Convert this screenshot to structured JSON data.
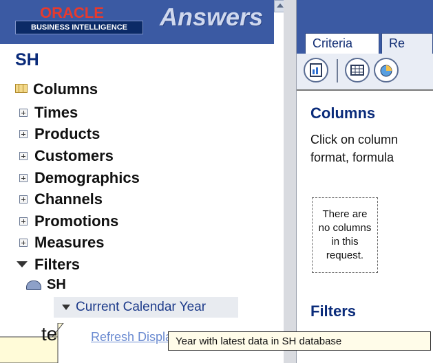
{
  "header": {
    "oracle_label": "ORACLE",
    "bi_label": "BUSINESS INTELLIGENCE",
    "app_title": "Answers"
  },
  "left": {
    "subject_area": "SH",
    "columns_label": "Columns",
    "tree": [
      "Times",
      "Products",
      "Customers",
      "Demographics",
      "Channels",
      "Promotions",
      "Measures"
    ],
    "filters_label": "Filters",
    "filter_group": "SH",
    "filter_item": "Current Calendar Year",
    "refresh_label": "Refresh Display"
  },
  "right": {
    "tabs": [
      "Criteria",
      "Re"
    ],
    "columns_title": "Columns",
    "columns_desc_line1": "Click on column",
    "columns_desc_line2": "format, formula",
    "empty_notice": "There are no columns in this request.",
    "filters_title": "Filters"
  },
  "tooltip": "Year with latest data in SH database",
  "callout_text": "te",
  "colors": {
    "header_blue": "#3b5aa3",
    "title_blue": "#0a2b7a",
    "oracle_red": "#e63a2e",
    "link_blue": "#6b8bd1",
    "tooltip_bg": "#fffce9"
  },
  "icons": [
    "scroll-up-icon",
    "columns-icon",
    "plus-icon",
    "filter-icon",
    "database-icon",
    "chart-icon",
    "table-icon",
    "pie-icon"
  ]
}
